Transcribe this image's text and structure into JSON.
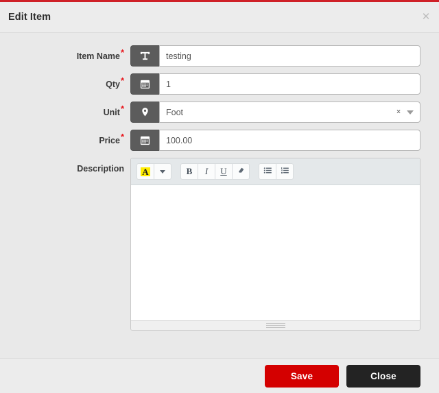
{
  "dialog": {
    "title": "Edit Item",
    "close_icon": "close-icon",
    "accent_color": "#cf2027"
  },
  "form": {
    "fields": [
      {
        "label": "Item Name",
        "required": true,
        "icon": "text-format-icon",
        "value": "testing",
        "type": "text"
      },
      {
        "label": "Qty",
        "required": true,
        "icon": "calendar-icon",
        "value": "1",
        "type": "text"
      },
      {
        "label": "Unit",
        "required": true,
        "icon": "map-pin-icon",
        "value": "Foot",
        "type": "select",
        "clear_icon": "clear-icon",
        "clear_label": "×",
        "caret_icon": "chevron-down-icon"
      },
      {
        "label": "Price",
        "required": true,
        "icon": "calendar-icon",
        "value": "100.00",
        "type": "text"
      }
    ],
    "description": {
      "label": "Description",
      "required": false,
      "content": "",
      "toolbar": [
        {
          "name": "text-color-button",
          "label": "A",
          "icon": "text-color-icon"
        },
        {
          "name": "text-color-dropdown-button",
          "label": "",
          "icon": "chevron-down-icon"
        },
        {
          "name": "bold-button",
          "label": "B",
          "icon": "bold-icon"
        },
        {
          "name": "italic-button",
          "label": "I",
          "icon": "italic-icon"
        },
        {
          "name": "underline-button",
          "label": "U",
          "icon": "underline-icon"
        },
        {
          "name": "clear-formatting-button",
          "label": "",
          "icon": "eraser-icon"
        },
        {
          "name": "unordered-list-button",
          "label": "",
          "icon": "bullet-list-icon"
        },
        {
          "name": "ordered-list-button",
          "label": "",
          "icon": "numbered-list-icon"
        }
      ],
      "resize_handle_icon": "resize-grip-icon"
    }
  },
  "footer": {
    "save_label": "Save",
    "close_label": "Close",
    "save_color": "#d40000",
    "close_color": "#232323"
  }
}
